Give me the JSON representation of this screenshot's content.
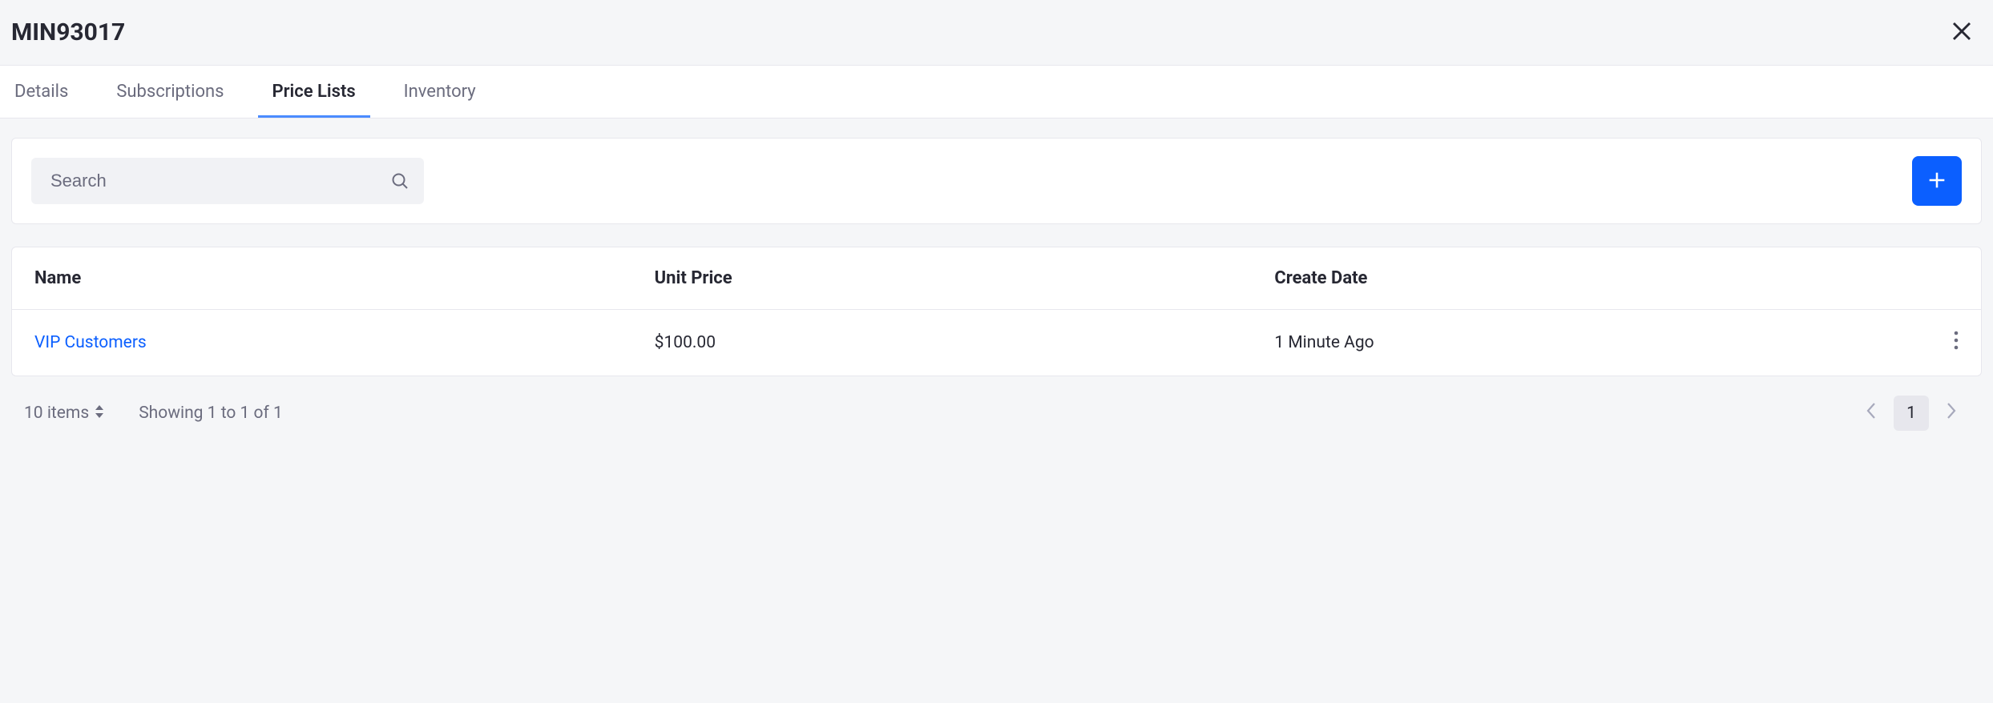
{
  "header": {
    "title": "MIN93017"
  },
  "tabs": [
    {
      "label": "Details",
      "active": false
    },
    {
      "label": "Subscriptions",
      "active": false
    },
    {
      "label": "Price Lists",
      "active": true
    },
    {
      "label": "Inventory",
      "active": false
    }
  ],
  "toolbar": {
    "search_placeholder": "Search"
  },
  "table": {
    "columns": {
      "name": "Name",
      "unit_price": "Unit Price",
      "create_date": "Create Date"
    },
    "rows": [
      {
        "name": "VIP Customers",
        "unit_price": "$100.00",
        "create_date": "1 Minute Ago"
      }
    ]
  },
  "footer": {
    "items_label": "10 items",
    "showing": "Showing 1 to 1 of 1",
    "current_page": "1"
  }
}
